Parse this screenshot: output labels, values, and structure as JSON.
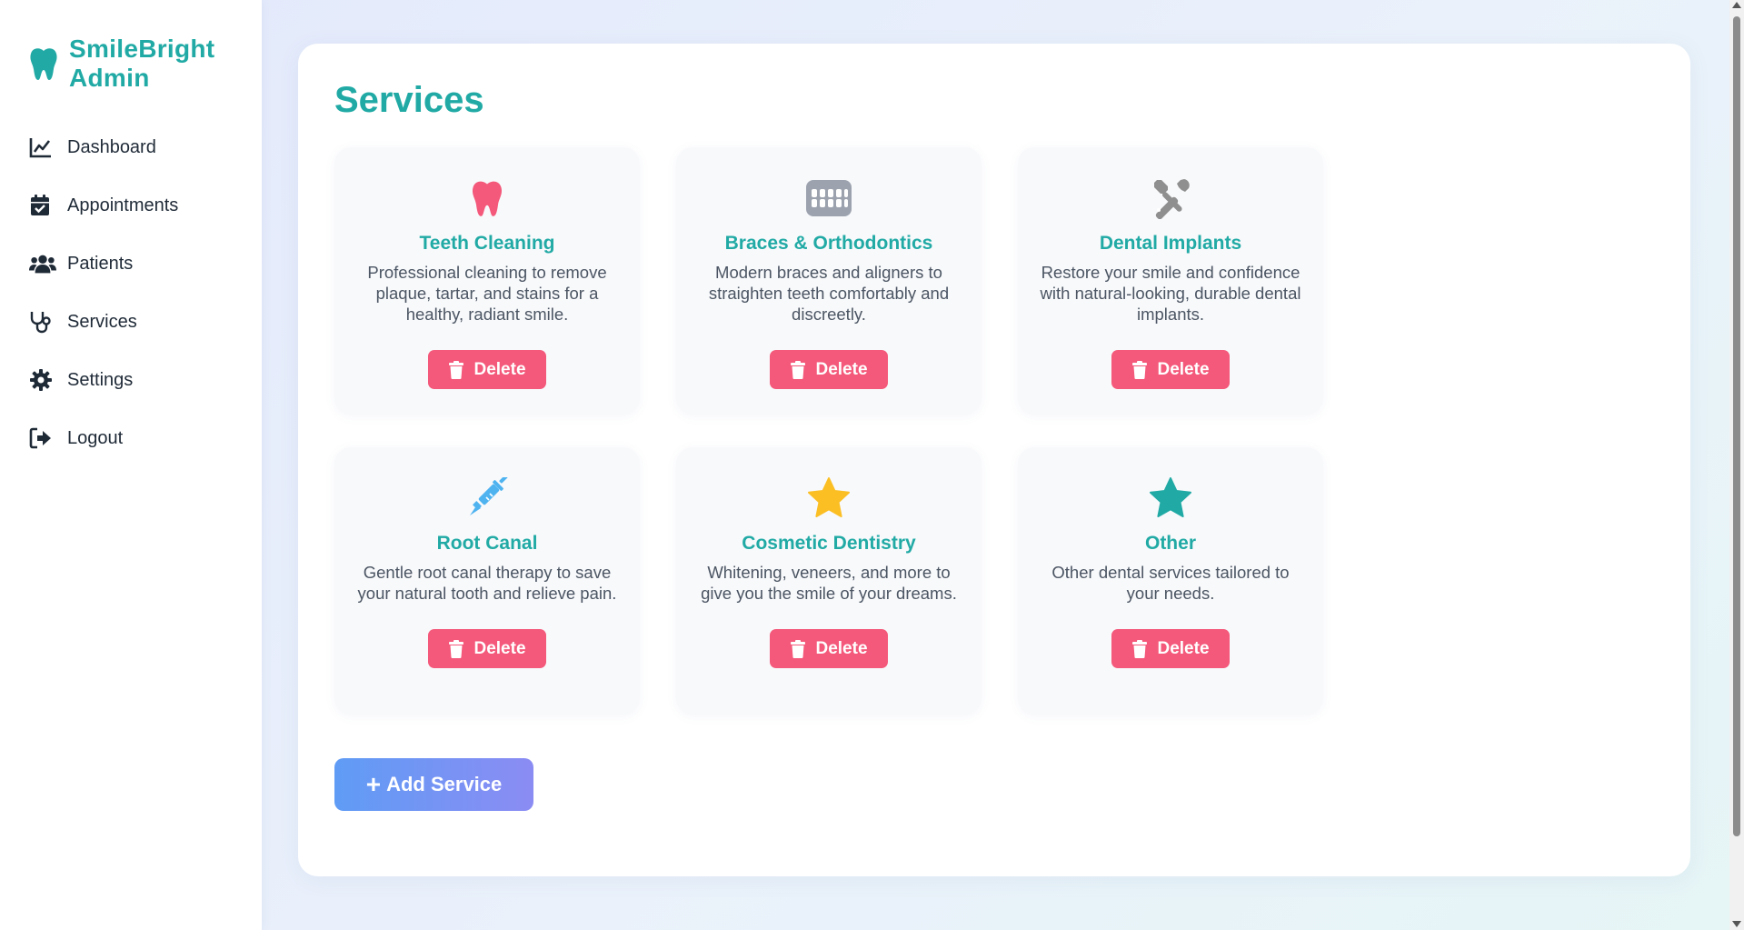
{
  "brand": {
    "line1": "SmileBright",
    "line2": "Admin",
    "icon": "tooth-icon",
    "color": "#21aaa5"
  },
  "sidebar": {
    "items": [
      {
        "label": "Dashboard",
        "icon": "chart-line-icon"
      },
      {
        "label": "Appointments",
        "icon": "calendar-check-icon"
      },
      {
        "label": "Patients",
        "icon": "users-icon"
      },
      {
        "label": "Services",
        "icon": "stethoscope-icon"
      },
      {
        "label": "Settings",
        "icon": "gear-icon"
      },
      {
        "label": "Logout",
        "icon": "logout-icon"
      }
    ]
  },
  "main": {
    "title": "Services",
    "services": [
      {
        "title": "Teeth Cleaning",
        "description": "Professional cleaning to remove plaque, tartar, and stains for a healthy, radiant smile.",
        "icon": "tooth-icon",
        "icon_color": "#f4587a",
        "delete_label": "Delete"
      },
      {
        "title": "Braces & Orthodontics",
        "description": "Modern braces and aligners to straighten teeth comfortably and discreetly.",
        "icon": "teeth-braces-icon",
        "icon_color": "#9ca3af",
        "delete_label": "Delete"
      },
      {
        "title": "Dental Implants",
        "description": "Restore your smile and confidence with natural-looking, durable dental implants.",
        "icon": "tools-icon",
        "icon_color": "#8f8f8f",
        "delete_label": "Delete"
      },
      {
        "title": "Root Canal",
        "description": "Gentle root canal therapy to save your natural tooth and relieve pain.",
        "icon": "syringe-icon",
        "icon_color": "#4fb3f0",
        "delete_label": "Delete"
      },
      {
        "title": "Cosmetic Dentistry",
        "description": "Whitening, veneers, and more to give you the smile of your dreams.",
        "icon": "star-icon",
        "icon_color": "#fbbf24",
        "delete_label": "Delete"
      },
      {
        "title": "Other",
        "description": "Other dental services tailored to your needs.",
        "icon": "star-icon",
        "icon_color": "#21aaa5",
        "delete_label": "Delete"
      }
    ],
    "add_label": "Add Service"
  },
  "colors": {
    "accent": "#21aaa5",
    "danger": "#f4587a",
    "gradient_start": "#5f9cf5",
    "gradient_end": "#8b8cf3"
  }
}
